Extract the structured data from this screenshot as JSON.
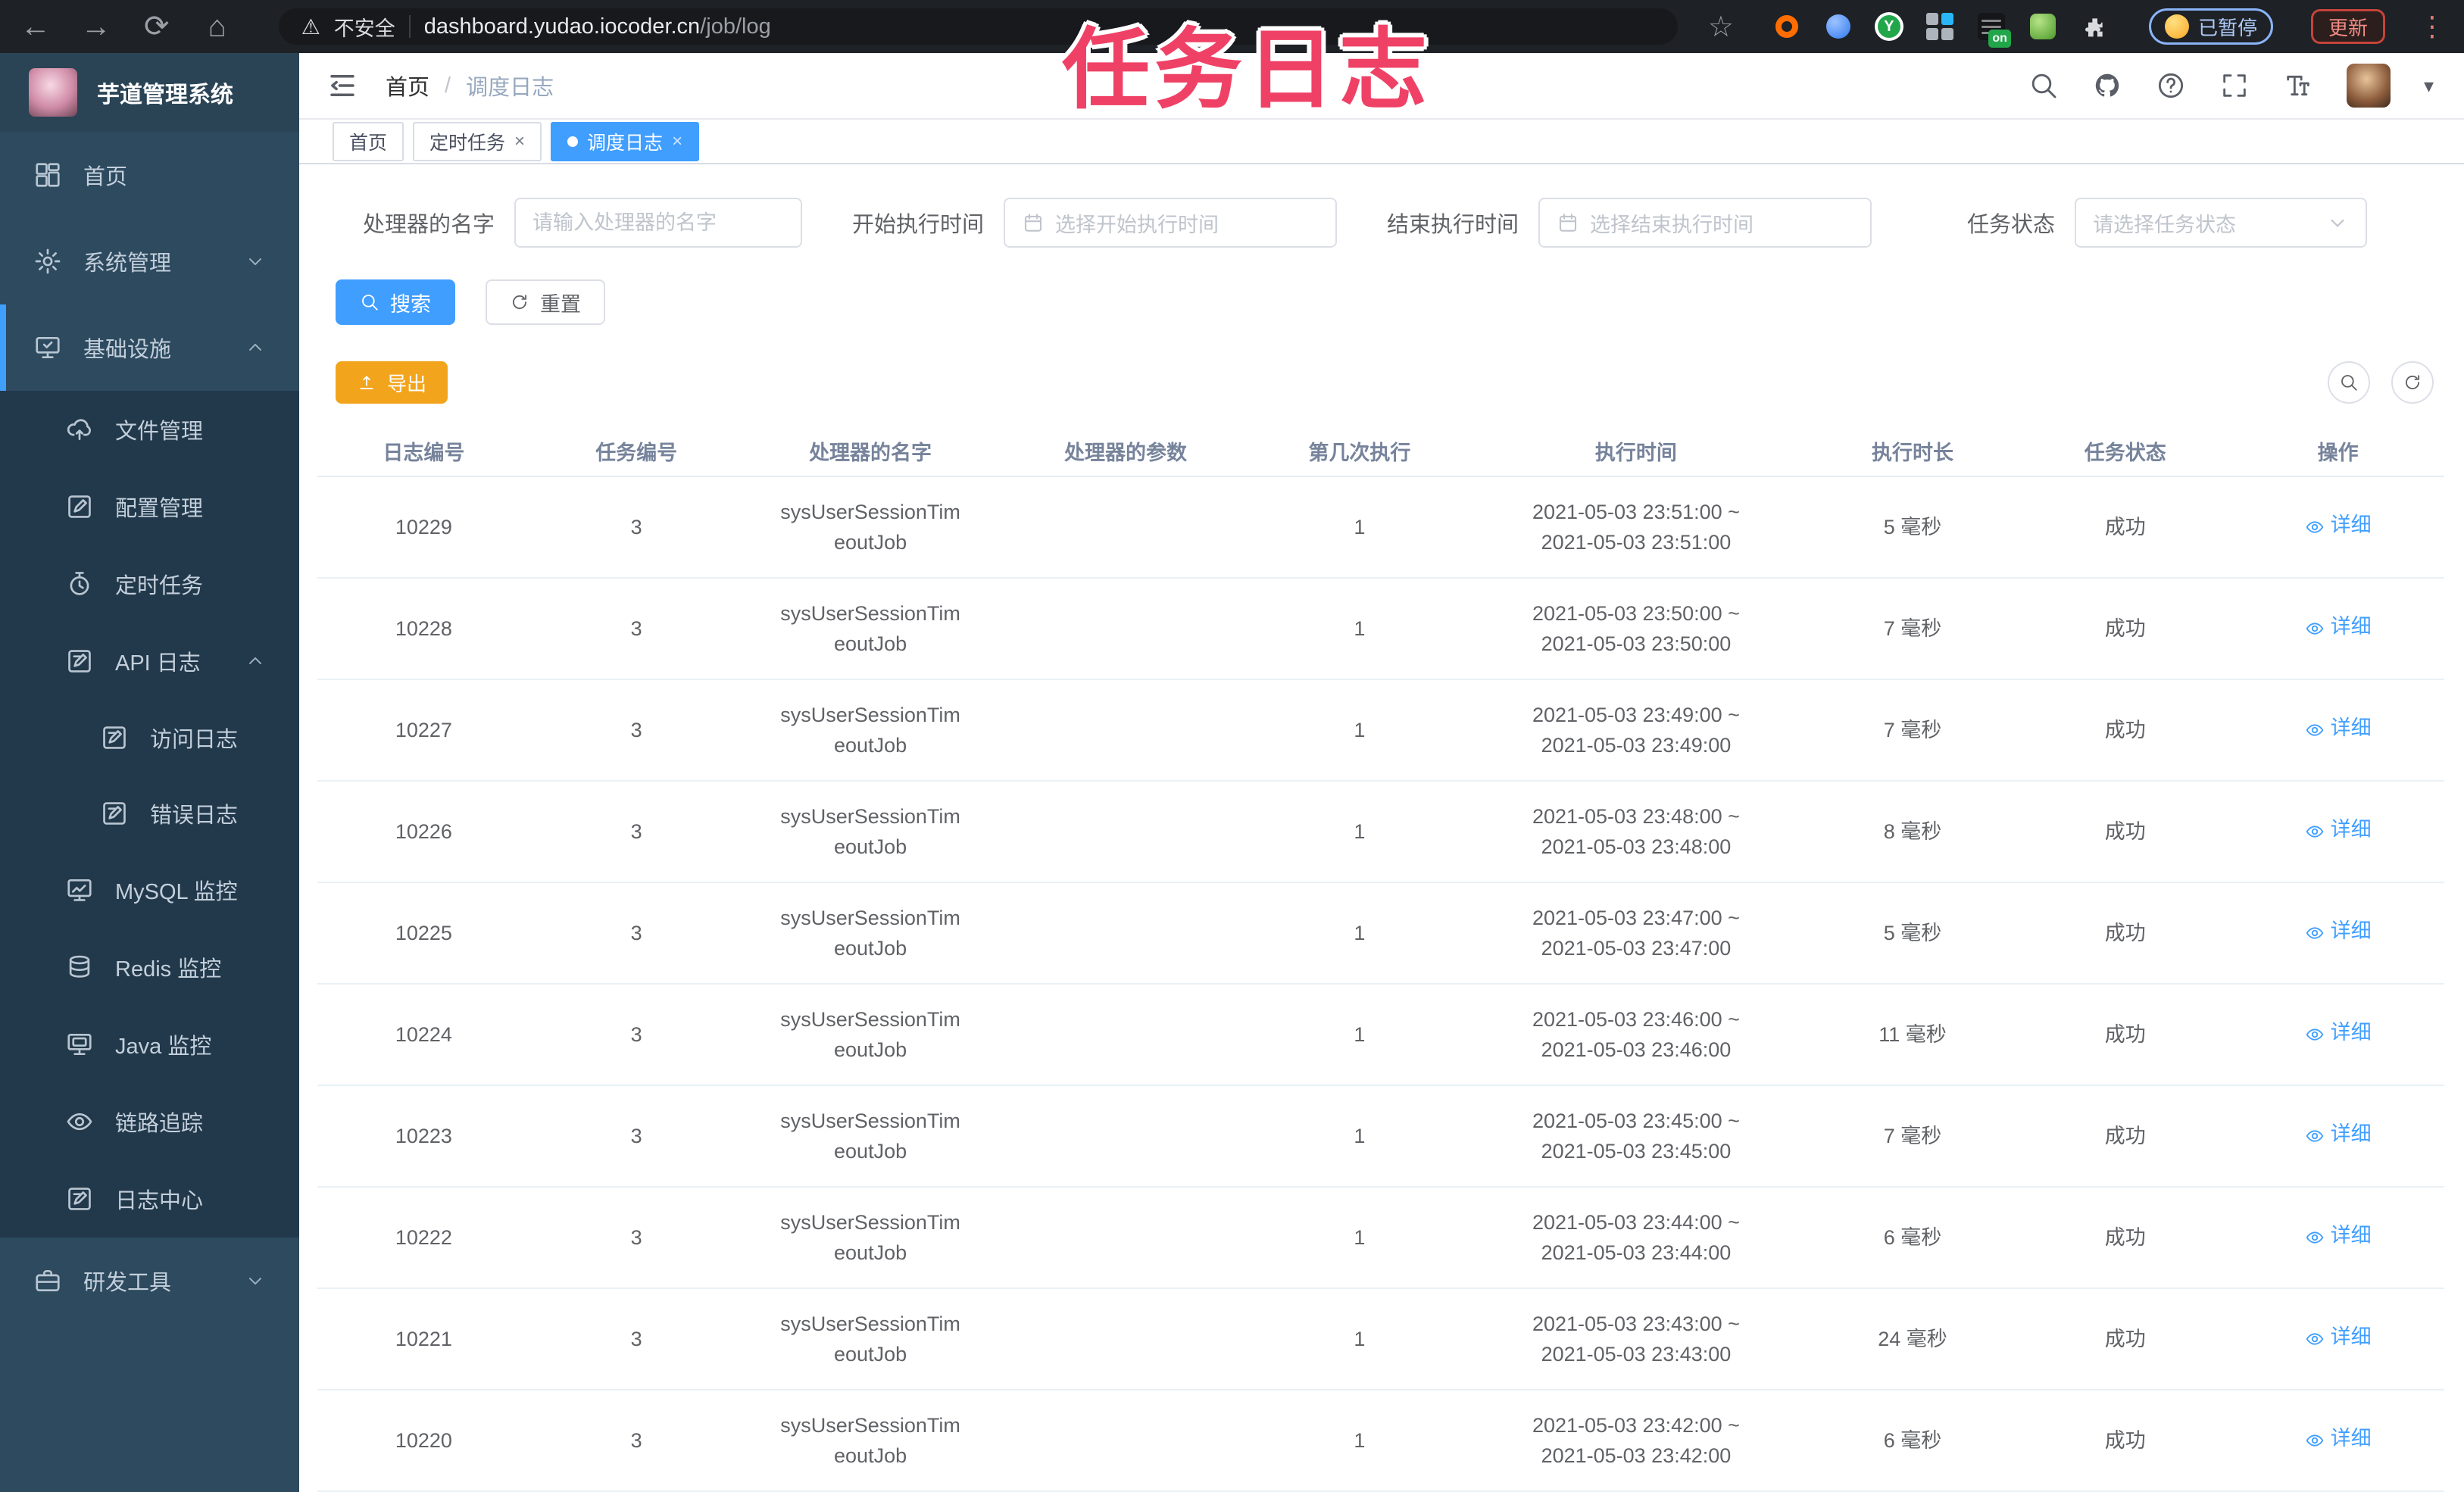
{
  "overlay_title": "任务日志",
  "colors": {
    "primary": "#409eff",
    "warning": "#f2a51c",
    "overlay_pink": "#ef4166",
    "sidebar_bg": "#2d4a5f",
    "sidebar_sub_bg": "#22394b"
  },
  "browser": {
    "back_glyph": "←",
    "forward_glyph": "→",
    "reload_glyph": "⟳",
    "home_glyph": "⌂",
    "warning_glyph": "⚠",
    "security_label": "不安全",
    "url_host": "dashboard.yudao.iocoder.cn",
    "url_path": "/job/log",
    "star_glyph": "☆",
    "on_badge": "on",
    "ext_y_letter": "Y",
    "paused_badge": "已暂停",
    "update_button": "更新",
    "menu_dots_glyph": "⋮"
  },
  "sidebar": {
    "app_title": "芋道管理系统",
    "items": [
      {
        "id": "home",
        "label": "首页",
        "icon": "dashboard-icon",
        "level": "top"
      },
      {
        "id": "system",
        "label": "系统管理",
        "icon": "gear-icon",
        "level": "top",
        "chevron": "down"
      },
      {
        "id": "infra",
        "label": "基础设施",
        "icon": "monitor-check-icon",
        "level": "top",
        "chevron": "up",
        "active": true
      },
      {
        "id": "file",
        "label": "文件管理",
        "icon": "cloud-upload-icon",
        "level": "sub"
      },
      {
        "id": "config",
        "label": "配置管理",
        "icon": "edit-icon",
        "level": "sub"
      },
      {
        "id": "job",
        "label": "定时任务",
        "icon": "timer-icon",
        "level": "sub"
      },
      {
        "id": "api-log",
        "label": "API 日志",
        "icon": "log-icon",
        "level": "sub",
        "chevron": "up"
      },
      {
        "id": "access-log",
        "label": "访问日志",
        "icon": "log-icon",
        "level": "sub2"
      },
      {
        "id": "error-log",
        "label": "错误日志",
        "icon": "log-icon",
        "level": "sub2"
      },
      {
        "id": "mysql",
        "label": "MySQL 监控",
        "icon": "mysql-monitor-icon",
        "level": "sub"
      },
      {
        "id": "redis",
        "label": "Redis 监控",
        "icon": "redis-icon",
        "level": "sub"
      },
      {
        "id": "java",
        "label": "Java 监控",
        "icon": "java-monitor-icon",
        "level": "sub"
      },
      {
        "id": "trace",
        "label": "链路追踪",
        "icon": "eye-icon",
        "level": "sub"
      },
      {
        "id": "log-center",
        "label": "日志中心",
        "icon": "log-icon",
        "level": "sub"
      },
      {
        "id": "dev-tools",
        "label": "研发工具",
        "icon": "toolbox-icon",
        "level": "top",
        "chevron": "down"
      }
    ]
  },
  "header": {
    "breadcrumb_home": "首页",
    "breadcrumb_sep": "/",
    "breadcrumb_current": "调度日志",
    "caret_glyph": "▾"
  },
  "tabs": {
    "close_glyph": "×",
    "items": [
      {
        "label": "首页",
        "active": false,
        "closable": false,
        "dot": false
      },
      {
        "label": "定时任务",
        "active": false,
        "closable": true,
        "dot": false
      },
      {
        "label": "调度日志",
        "active": true,
        "closable": true,
        "dot": true
      }
    ]
  },
  "filters": {
    "handler_label": "处理器的名字",
    "handler_placeholder": "请输入处理器的名字",
    "start_label": "开始执行时间",
    "start_placeholder": "选择开始执行时间",
    "end_label": "结束执行时间",
    "end_placeholder": "选择结束执行时间",
    "status_label": "任务状态",
    "status_placeholder": "请选择任务状态"
  },
  "toolbar": {
    "search_label": "搜索",
    "reset_label": "重置",
    "export_label": "导出"
  },
  "table": {
    "columns": [
      "日志编号",
      "任务编号",
      "处理器的名字",
      "处理器的参数",
      "第几次执行",
      "执行时间",
      "执行时长",
      "任务状态",
      "操作"
    ],
    "action_label": "详细",
    "rows": [
      {
        "log_id": "10229",
        "job_id": "3",
        "handler1": "sysUserSessionTim",
        "handler2": "eoutJob",
        "param": "",
        "exec_index": "1",
        "time1": "2021-05-03 23:51:00 ~",
        "time2": "2021-05-03 23:51:00",
        "duration": "5 毫秒",
        "status": "成功"
      },
      {
        "log_id": "10228",
        "job_id": "3",
        "handler1": "sysUserSessionTim",
        "handler2": "eoutJob",
        "param": "",
        "exec_index": "1",
        "time1": "2021-05-03 23:50:00 ~",
        "time2": "2021-05-03 23:50:00",
        "duration": "7 毫秒",
        "status": "成功"
      },
      {
        "log_id": "10227",
        "job_id": "3",
        "handler1": "sysUserSessionTim",
        "handler2": "eoutJob",
        "param": "",
        "exec_index": "1",
        "time1": "2021-05-03 23:49:00 ~",
        "time2": "2021-05-03 23:49:00",
        "duration": "7 毫秒",
        "status": "成功"
      },
      {
        "log_id": "10226",
        "job_id": "3",
        "handler1": "sysUserSessionTim",
        "handler2": "eoutJob",
        "param": "",
        "exec_index": "1",
        "time1": "2021-05-03 23:48:00 ~",
        "time2": "2021-05-03 23:48:00",
        "duration": "8 毫秒",
        "status": "成功"
      },
      {
        "log_id": "10225",
        "job_id": "3",
        "handler1": "sysUserSessionTim",
        "handler2": "eoutJob",
        "param": "",
        "exec_index": "1",
        "time1": "2021-05-03 23:47:00 ~",
        "time2": "2021-05-03 23:47:00",
        "duration": "5 毫秒",
        "status": "成功"
      },
      {
        "log_id": "10224",
        "job_id": "3",
        "handler1": "sysUserSessionTim",
        "handler2": "eoutJob",
        "param": "",
        "exec_index": "1",
        "time1": "2021-05-03 23:46:00 ~",
        "time2": "2021-05-03 23:46:00",
        "duration": "11 毫秒",
        "status": "成功"
      },
      {
        "log_id": "10223",
        "job_id": "3",
        "handler1": "sysUserSessionTim",
        "handler2": "eoutJob",
        "param": "",
        "exec_index": "1",
        "time1": "2021-05-03 23:45:00 ~",
        "time2": "2021-05-03 23:45:00",
        "duration": "7 毫秒",
        "status": "成功"
      },
      {
        "log_id": "10222",
        "job_id": "3",
        "handler1": "sysUserSessionTim",
        "handler2": "eoutJob",
        "param": "",
        "exec_index": "1",
        "time1": "2021-05-03 23:44:00 ~",
        "time2": "2021-05-03 23:44:00",
        "duration": "6 毫秒",
        "status": "成功"
      },
      {
        "log_id": "10221",
        "job_id": "3",
        "handler1": "sysUserSessionTim",
        "handler2": "eoutJob",
        "param": "",
        "exec_index": "1",
        "time1": "2021-05-03 23:43:00 ~",
        "time2": "2021-05-03 23:43:00",
        "duration": "24 毫秒",
        "status": "成功"
      },
      {
        "log_id": "10220",
        "job_id": "3",
        "handler1": "sysUserSessionTim",
        "handler2": "eoutJob",
        "param": "",
        "exec_index": "1",
        "time1": "2021-05-03 23:42:00 ~",
        "time2": "2021-05-03 23:42:00",
        "duration": "6 毫秒",
        "status": "成功"
      }
    ]
  }
}
